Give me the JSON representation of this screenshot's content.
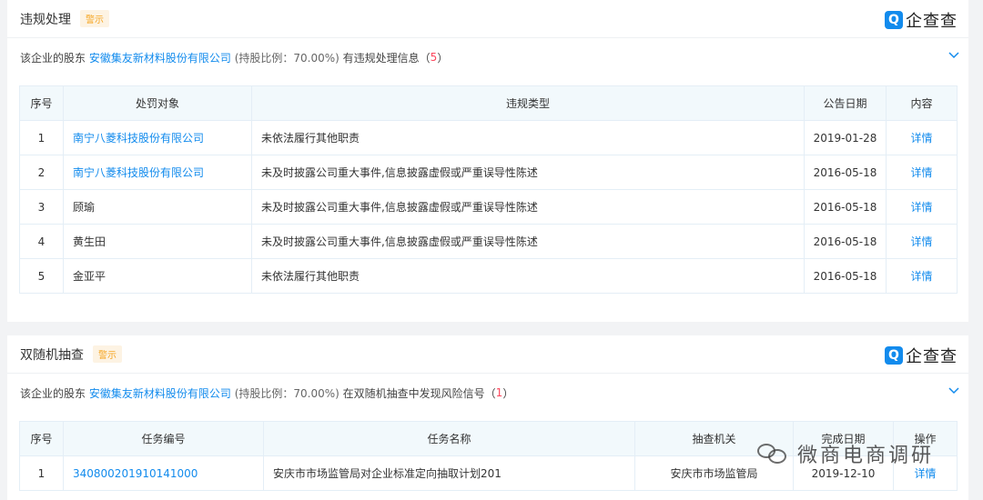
{
  "section1": {
    "title": "违规处理",
    "badge": "警示",
    "logo": {
      "mark": "Q",
      "text": "企查查"
    },
    "desc_prefix": "该企业的股东",
    "shareholder": "安徽集友新材料股份有限公司",
    "ratio": "(持股比例：70.00%)",
    "desc_suffix": "有违规处理信息",
    "count": "5",
    "headers": [
      "序号",
      "处罚对象",
      "违规类型",
      "公告日期",
      "内容"
    ],
    "rows": [
      {
        "no": "1",
        "target": "南宁八菱科技股份有限公司",
        "target_link": true,
        "type": "未依法履行其他职责",
        "date": "2019-01-28",
        "action": "详情"
      },
      {
        "no": "2",
        "target": "南宁八菱科技股份有限公司",
        "target_link": true,
        "type": "未及时披露公司重大事件,信息披露虚假或严重误导性陈述",
        "date": "2016-05-18",
        "action": "详情"
      },
      {
        "no": "3",
        "target": "顾瑜",
        "target_link": false,
        "type": "未及时披露公司重大事件,信息披露虚假或严重误导性陈述",
        "date": "2016-05-18",
        "action": "详情"
      },
      {
        "no": "4",
        "target": "黄生田",
        "target_link": false,
        "type": "未及时披露公司重大事件,信息披露虚假或严重误导性陈述",
        "date": "2016-05-18",
        "action": "详情"
      },
      {
        "no": "5",
        "target": "金亚平",
        "target_link": false,
        "type": "未依法履行其他职责",
        "date": "2016-05-18",
        "action": "详情"
      }
    ]
  },
  "section2": {
    "title": "双随机抽查",
    "badge": "警示",
    "logo": {
      "mark": "Q",
      "text": "企查查"
    },
    "desc_prefix": "该企业的股东",
    "shareholder": "安徽集友新材料股份有限公司",
    "ratio": "(持股比例：70.00%)",
    "desc_suffix": "在双随机抽查中发现风险信号",
    "count": "1",
    "headers": [
      "序号",
      "任务编号",
      "任务名称",
      "抽查机关",
      "完成日期",
      "操作"
    ],
    "rows": [
      {
        "no": "1",
        "task_no": "340800201910141000",
        "task_name": "安庆市市场监管局对企业标准定向抽取计划201",
        "authority": "安庆市市场监管局",
        "date": "2019-12-10",
        "action": "详情"
      }
    ]
  },
  "watermark": "微商电商调研",
  "colors": {
    "accent": "#128bed",
    "badge_text": "#f5a623",
    "count": "#fd485e"
  }
}
